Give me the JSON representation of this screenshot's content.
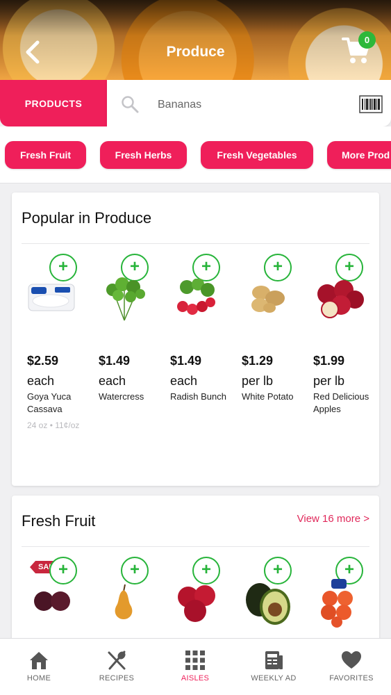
{
  "header": {
    "title": "Produce",
    "cart_count": "0"
  },
  "search": {
    "tab_label": "PRODUCTS",
    "placeholder": "Bananas"
  },
  "chips": [
    "Fresh Fruit",
    "Fresh Herbs",
    "Fresh Vegetables",
    "More Prod"
  ],
  "popular": {
    "title": "Popular in Produce",
    "items": [
      {
        "price": "$2.59",
        "unit": "each",
        "name": "Goya Yuca Cassava",
        "size": "24 oz • 11¢/oz",
        "icon": "yuca-package-image"
      },
      {
        "price": "$1.49",
        "unit": "each",
        "name": "Watercress",
        "size": "",
        "icon": "watercress-image"
      },
      {
        "price": "$1.49",
        "unit": "each",
        "name": "Radish Bunch",
        "size": "",
        "icon": "radish-image"
      },
      {
        "price": "$1.29",
        "unit": "per lb",
        "name": "White Potato",
        "size": "",
        "icon": "potato-image"
      },
      {
        "price": "$1.99",
        "unit": "per lb",
        "name": "Red Delicious Apples",
        "size": "",
        "icon": "apples-image"
      }
    ]
  },
  "fresh_fruit": {
    "title": "Fresh Fruit",
    "view_more": "View 16 more >",
    "sale_badge": "SALE",
    "items": [
      {
        "icon": "plums-image"
      },
      {
        "icon": "pear-image"
      },
      {
        "icon": "red-apples-image"
      },
      {
        "icon": "avocado-image"
      },
      {
        "icon": "oranges-bag-image"
      }
    ]
  },
  "nav": [
    {
      "label": "HOME",
      "icon": "home-icon",
      "active": false
    },
    {
      "label": "RECIPES",
      "icon": "recipes-icon",
      "active": false
    },
    {
      "label": "AISLES",
      "icon": "aisles-icon",
      "active": true
    },
    {
      "label": "WEEKLY AD",
      "icon": "weekly-ad-icon",
      "active": false
    },
    {
      "label": "FAVORITES",
      "icon": "favorites-icon",
      "active": false
    }
  ],
  "colors": {
    "accent": "#ef1f5a",
    "add_green": "#27b43a",
    "badge_green": "#2db83a"
  }
}
